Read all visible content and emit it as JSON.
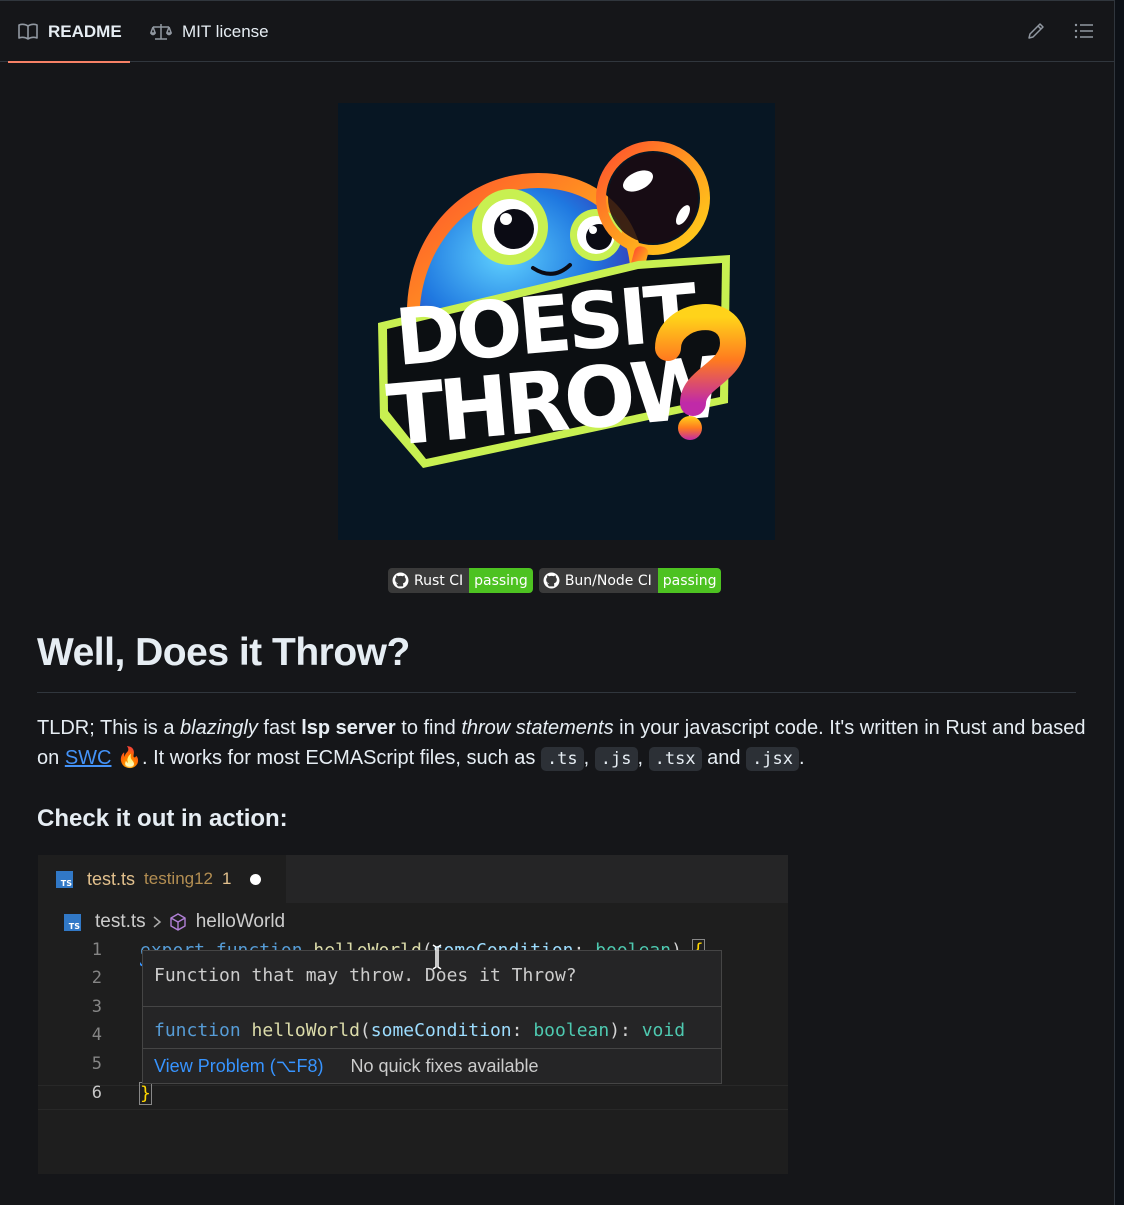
{
  "tabs": {
    "readme": {
      "label": "README"
    },
    "license": {
      "label": "MIT license"
    }
  },
  "toolbar": {
    "edit_icon": "pencil-icon",
    "outline_icon": "list-unordered-icon"
  },
  "logo": {
    "line1": "DOESIT",
    "line2": "THROW?"
  },
  "badges": [
    {
      "label": "Rust CI",
      "status": "passing"
    },
    {
      "label": "Bun/Node CI",
      "status": "passing"
    }
  ],
  "title": "Well, Does it Throw?",
  "intro": {
    "t1": "TLDR; This is a ",
    "em1": "blazingly",
    "t2": " fast ",
    "strong": "lsp server",
    "t3": " to find ",
    "em2": "throw statements",
    "t4": " in your javascript code. It's written in Rust and based on ",
    "link": "SWC",
    "emoji": "🔥",
    "t5": ". It works for most ECMAScript files, such as ",
    "code1": ".ts",
    "sep1": ", ",
    "code2": ".js",
    "sep2": ", ",
    "code3": ".tsx",
    "t6": " and ",
    "code4": ".jsx",
    "t7": "."
  },
  "subtitle": "Check it out in action:",
  "editor": {
    "tab": {
      "icon": "TS",
      "name": "test.ts",
      "desc": "testing12",
      "count": "1"
    },
    "breadcrumb": {
      "file": "test.ts",
      "symbol": "helloWorld"
    },
    "line_numbers": [
      "1",
      "2",
      "3",
      "4",
      "5",
      "6"
    ],
    "line1": {
      "kw": "export",
      "kw2": "function",
      "fn": "helloWorld",
      "paren": "(",
      "param": "someCondition",
      "colon": ": ",
      "type": "boolean",
      "close": ")",
      "brace": "{"
    },
    "line6": {
      "brace": "}"
    },
    "hover": {
      "message": "Function that may throw. Does it Throw?",
      "sig": {
        "kw": "function",
        "fn": "helloWorld",
        "open": "(",
        "param": "someCondition",
        "colon": ": ",
        "type": "boolean",
        "close": "): ",
        "ret": "void"
      },
      "view_problem": "View Problem (⌥F8)",
      "no_fixes": "No quick fixes available"
    }
  }
}
